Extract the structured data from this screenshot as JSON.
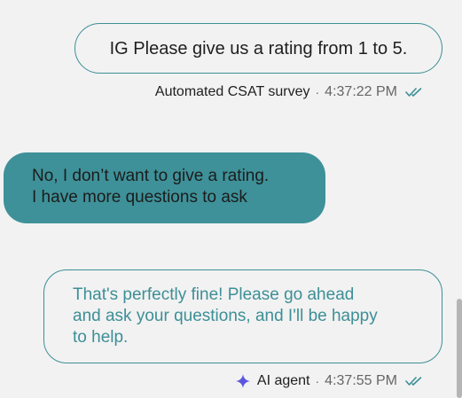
{
  "messages": [
    {
      "text": "IG Please give us a rating from 1 to 5.",
      "sender": "Automated CSAT survey",
      "time": "4:37:22 PM",
      "separator": "·"
    },
    {
      "lines": [
        "No, I don’t want to give a rating.",
        "I have more questions to ask"
      ]
    },
    {
      "lines": [
        "That's perfectly fine! Please go ahead",
        "and ask your questions, and I'll be happy",
        "to help."
      ],
      "sender": "AI agent",
      "time": "4:37:55 PM",
      "separator": "·"
    }
  ],
  "icons": {
    "read_receipt": "double-check-icon",
    "ai_agent": "sparkle-icon"
  },
  "colors": {
    "accent": "#3e9199",
    "sparkle": "#5a55e0",
    "background": "#f2f2f2"
  }
}
